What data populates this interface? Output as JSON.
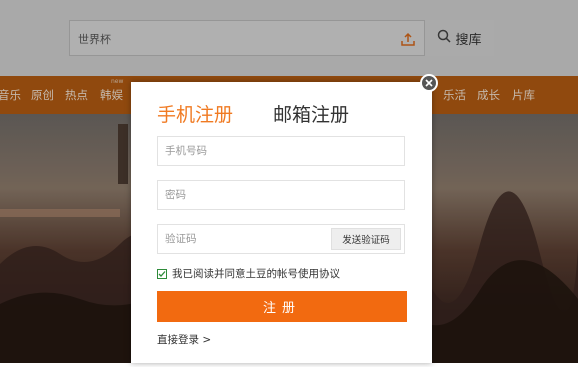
{
  "search": {
    "placeholder": "世界杯",
    "button_label": "搜库",
    "upload_icon": "upload-icon",
    "search_icon": "search-icon"
  },
  "nav": {
    "items": [
      "音乐",
      "原创",
      "热点",
      "韩娱",
      "乐活",
      "成长",
      "片库"
    ],
    "new_badge": "new"
  },
  "modal": {
    "tabs": {
      "phone": "手机注册",
      "email": "邮箱注册"
    },
    "phone_placeholder": "手机号码",
    "password_placeholder": "密码",
    "code_placeholder": "验证码",
    "send_code_label": "发送验证码",
    "agreement_text": "我已阅读并同意土豆的帐号使用协议",
    "agreement_checked": true,
    "register_label": "注册",
    "login_link": "直接登录 >",
    "close_icon": "close-icon"
  },
  "colors": {
    "accent": "#f26a10",
    "active_tab": "#f07a22",
    "nav_bg": "#b05a12",
    "checkbox": "#2e8b3a"
  }
}
